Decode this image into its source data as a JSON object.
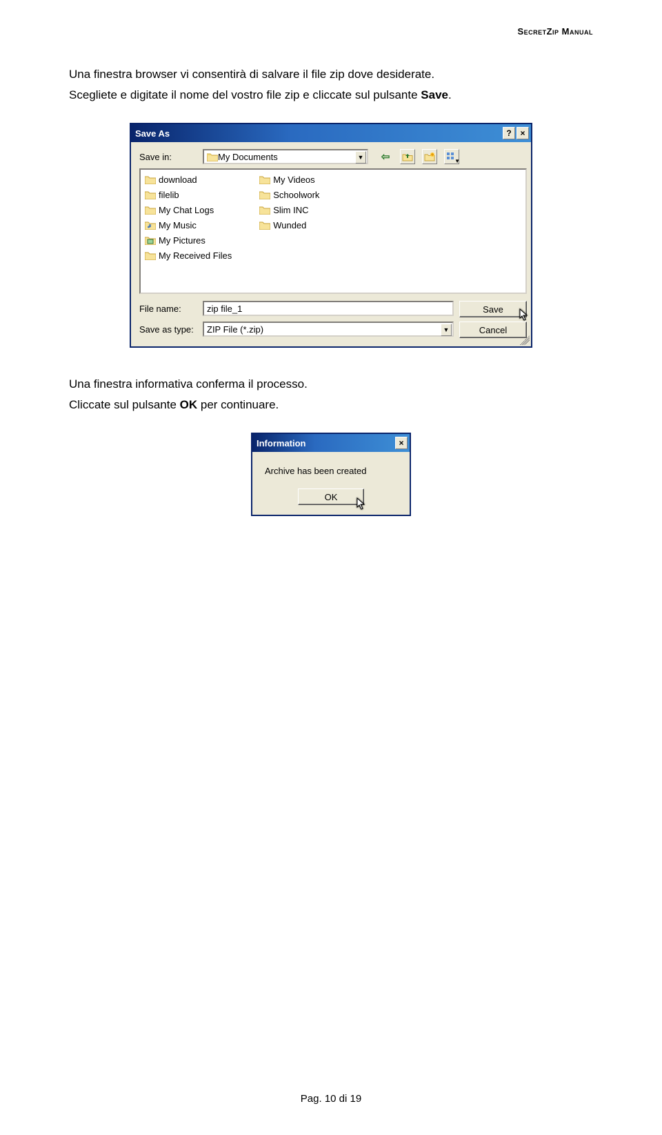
{
  "header": {
    "manual_title": "SecretZip Manual"
  },
  "para1": "Una finestra browser vi consentirà di salvare il file zip dove desiderate.",
  "para2_pre": "Scegliete e digitate il nome del vostro file zip e cliccate sul pulsante ",
  "para2_bold": "Save",
  "para2_post": ".",
  "saveas": {
    "title": "Save As",
    "help_icon": "?",
    "close_icon": "×",
    "savein_label": "Save in:",
    "savein_value": "My Documents",
    "toolbar": {
      "back": "⇦",
      "up": "folder-up",
      "newfolder": "new-folder",
      "viewmode": "view-grid"
    },
    "folders_col1": [
      "download",
      "filelib",
      "My Chat Logs",
      "My Music",
      "My Pictures",
      "My Received Files"
    ],
    "folders_col2": [
      "My Videos",
      "Schoolwork",
      "Slim INC",
      "Wunded"
    ],
    "filename_label": "File name:",
    "filename_value": "zip file_1",
    "saveastype_label": "Save as type:",
    "saveastype_value": "ZIP File (*.zip)",
    "save_btn": "Save",
    "cancel_btn": "Cancel"
  },
  "para3": "Una finestra informativa conferma il processo.",
  "para4_pre": "Cliccate sul pulsante ",
  "para4_bold": "OK",
  "para4_post": " per continuare.",
  "info": {
    "title": "Information",
    "close_icon": "×",
    "msg": "Archive has been created",
    "ok_btn": "OK"
  },
  "footer": {
    "page_label": "Pag. 10 di 19"
  }
}
